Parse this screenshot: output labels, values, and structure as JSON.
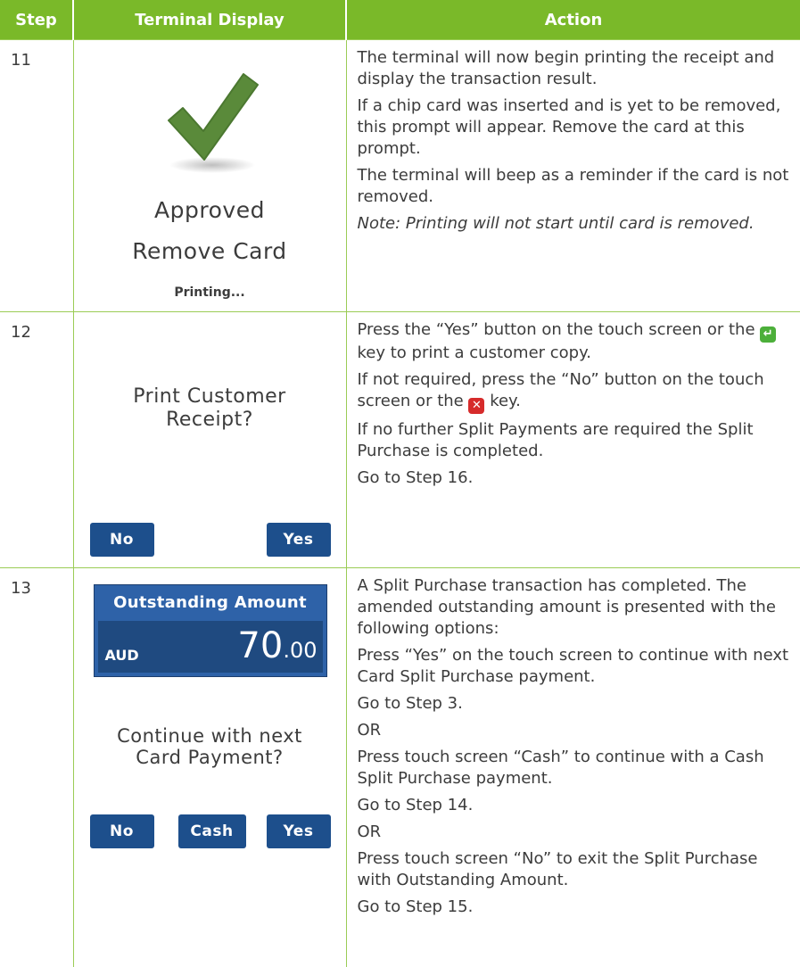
{
  "header": {
    "step": "Step",
    "display": "Terminal Display",
    "action": "Action"
  },
  "rows": [
    {
      "step": "11",
      "display": {
        "line1": "Approved",
        "line2": "Remove Card",
        "line3": "Printing..."
      },
      "action": [
        "The terminal will now begin printing the receipt and display the transaction result.",
        "If a chip card was inserted and is yet to be removed, this prompt will appear. Remove the card at this prompt.",
        "The terminal will beep as a reminder if the card is not removed.",
        "Note: Printing will not start until card is removed."
      ]
    },
    {
      "step": "12",
      "display": {
        "line1": "Print Customer",
        "line2": "Receipt?",
        "btn_no": "No",
        "btn_yes": "Yes"
      },
      "action": {
        "p1_a": "Press the “Yes” button on the touch screen or the ",
        "p1_b": " key to print a customer copy.",
        "p2_a": "If not required, press the “No” button on the touch screen or the ",
        "p2_b": " key.",
        "p3": "If no further Split Payments are required the Split Purchase is completed.",
        "p4": "Go to Step 16.",
        "enter_icon": "enter-key-icon",
        "cancel_icon": "cancel-key-icon"
      }
    },
    {
      "step": "13",
      "display": {
        "amount_title": "Outstanding Amount",
        "currency": "AUD",
        "amount_main": "70",
        "amount_cents": ".00",
        "line1": "Continue with next",
        "line2": "Card Payment?",
        "btn_no": "No",
        "btn_cash": "Cash",
        "btn_yes": "Yes"
      },
      "action": [
        "A Split Purchase transaction has completed. The amended outstanding amount is presented with the following options:",
        "Press “Yes” on the touch screen to continue with next Card Split Purchase payment.",
        "Go to Step 3.",
        "OR",
        "Press touch screen “Cash” to continue with a Cash Split Purchase payment.",
        "Go to Step 14.",
        "OR",
        "Press touch screen “No” to exit the Split Purchase with Outstanding Amount.",
        "Go to Step 15."
      ]
    }
  ],
  "colors": {
    "header_green": "#7ab929",
    "button_blue": "#1d4f8c",
    "check_green": "#5a8a3a"
  }
}
